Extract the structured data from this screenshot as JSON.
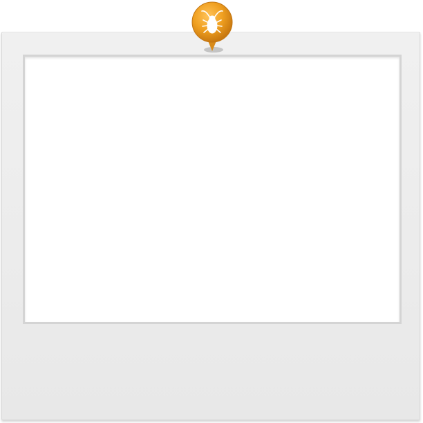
{
  "frame": {
    "background_color": "#ececec",
    "photo_area_color": "#ffffff"
  },
  "pin": {
    "icon": "beetle-icon",
    "color": "#f0a020"
  }
}
